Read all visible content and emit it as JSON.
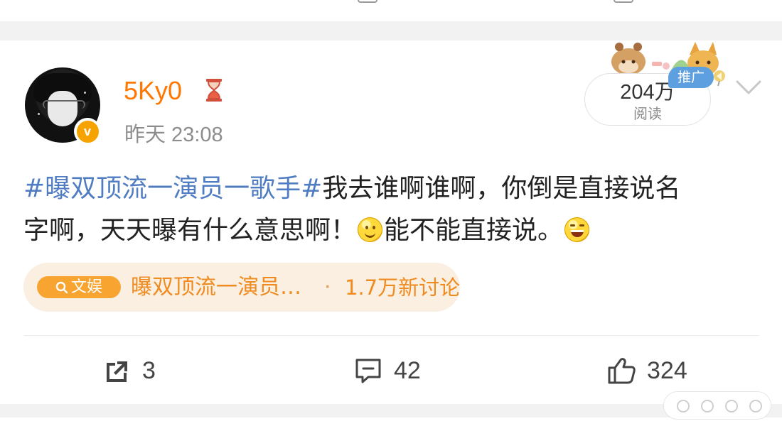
{
  "post": {
    "username": "5Ky0",
    "time": "昨天 23:08",
    "views": {
      "count": "204万",
      "label": "阅读"
    },
    "promotion_label": "推广",
    "text": {
      "hashtag": "#曝双顶流一演员一歌手#",
      "line1_rest": "我去谁啊谁啊，你倒是直接说名",
      "line2_before_emoji": "字啊，天天曝有什么意思啊！",
      "line2_after_smile": "能不能直接说。"
    },
    "topic": {
      "tag": "文娱",
      "title": "曝双顶流一演员…",
      "separator": "·",
      "count": "1.7万新讨论"
    },
    "actions": {
      "shares": "3",
      "comments": "42",
      "likes": "324"
    }
  },
  "icons": {
    "verified": "verified-icon",
    "status": "hourglass-icon",
    "more": "chevron-down-icon",
    "share": "share-icon",
    "comment": "comment-icon",
    "like": "like-icon",
    "emoji_1": "smile-emoji-icon",
    "emoji_2": "laugh-emoji-icon"
  },
  "colors": {
    "username": "#ff7600",
    "hashtag": "#4f7cc2",
    "topic_accent": "#ef8b1f",
    "topic_background": "#fbefe1",
    "promo_badge": "#5e9fe0"
  }
}
